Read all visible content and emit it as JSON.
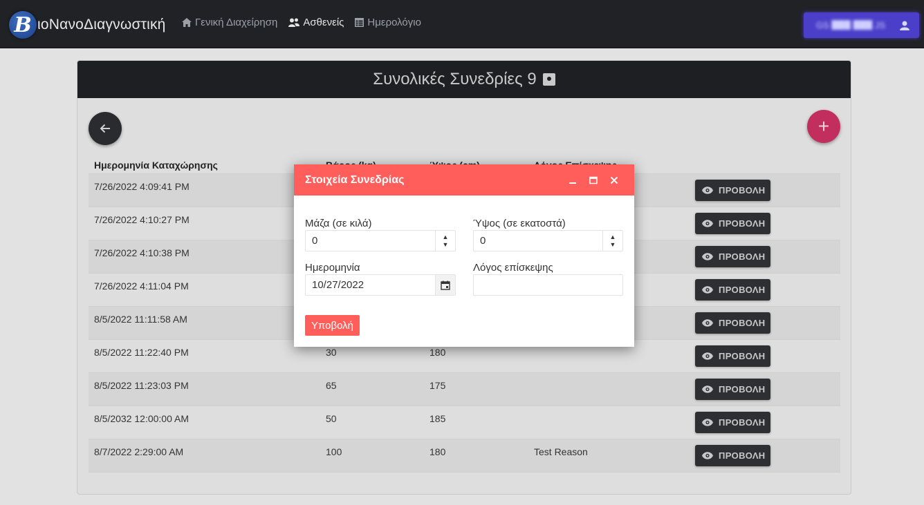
{
  "navbar": {
    "brand_initial": "B",
    "brand_text": "ιoΝανοΔιαγνωστική",
    "links": [
      {
        "label": "Γενική Διαχείρηση",
        "icon": "home-icon",
        "active": false
      },
      {
        "label": "Ασθενείς",
        "icon": "users-icon",
        "active": true
      },
      {
        "label": "Ημερολόγιο",
        "icon": "calendar-table-icon",
        "active": false
      }
    ],
    "user_name": "GS ███ ███ JS",
    "user_icon": "user-icon"
  },
  "card": {
    "title": "Συνολικές Συνεδρίες 9",
    "add_label": "+"
  },
  "table": {
    "headers": [
      "Ημερομηνία Καταχώρησης",
      "Βάρος (kg)",
      "Ύψος (cm)",
      "Λόγος Επίσκεψης",
      ""
    ],
    "view_label": "ΠΡΟΒΟΛΗ",
    "rows": [
      {
        "date": "7/26/2022 4:09:41 PM",
        "weight": "",
        "height": "",
        "reason": ""
      },
      {
        "date": "7/26/2022 4:10:27 PM",
        "weight": "",
        "height": "",
        "reason": ""
      },
      {
        "date": "7/26/2022 4:10:38 PM",
        "weight": "",
        "height": "",
        "reason": ""
      },
      {
        "date": "7/26/2022 4:11:04 PM",
        "weight": "",
        "height": "",
        "reason": ""
      },
      {
        "date": "8/5/2022 11:11:58 AM",
        "weight": "",
        "height": "",
        "reason": ""
      },
      {
        "date": "8/5/2022 11:22:40 PM",
        "weight": "30",
        "height": "180",
        "reason": ""
      },
      {
        "date": "8/5/2022 11:23:03 PM",
        "weight": "65",
        "height": "175",
        "reason": ""
      },
      {
        "date": "8/5/2032 12:00:00 AM",
        "weight": "50",
        "height": "185",
        "reason": ""
      },
      {
        "date": "8/7/2022 2:29:00 AM",
        "weight": "100",
        "height": "180",
        "reason": "Test Reason"
      }
    ]
  },
  "modal": {
    "title": "Στοιχεία Συνεδρίας",
    "mass_label": "Μάζα (σε κιλά)",
    "mass_value": "0",
    "height_label": "Ύψος (σε εκατοστά)",
    "height_value": "0",
    "date_label": "Ημερομηνία",
    "date_value": "10/27/2022",
    "reason_label": "Λόγος επίσκεψης",
    "reason_value": "",
    "submit_label": "Υποβολή"
  },
  "colors": {
    "navbar_bg": "#212226",
    "modal_accent": "#ff5e5b",
    "add_button": "#c22f5e",
    "user_box": "#4b3fc9"
  }
}
